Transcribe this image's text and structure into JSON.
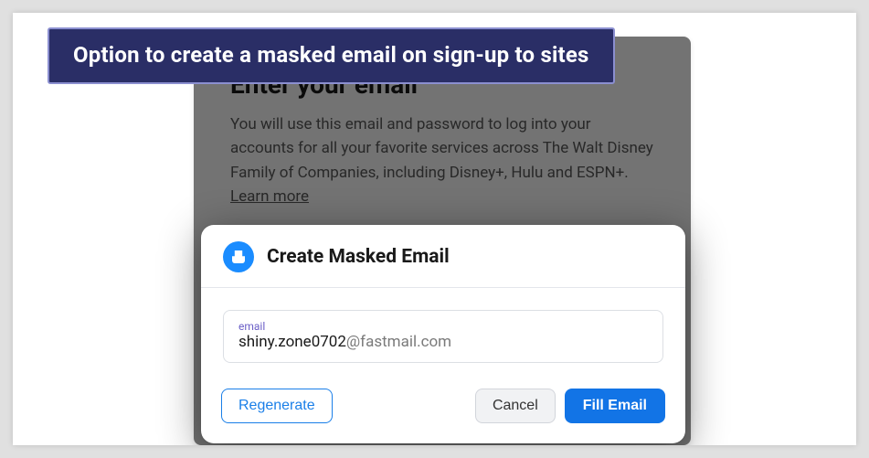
{
  "caption": "Option to create a masked email on sign-up to sites",
  "signup": {
    "title": "Enter your email",
    "description_prefix": "You will use this email and password to log into your accounts for all your favorite services across The Walt Disney Family of Companies, including Disney+, Hulu and ESPN+. ",
    "learn_more": "Learn more"
  },
  "popup": {
    "title": "Create Masked Email",
    "field_label": "email",
    "email_local": "shiny.zone0702",
    "email_domain": "@fastmail.com",
    "regenerate_label": "Regenerate",
    "cancel_label": "Cancel",
    "fill_label": "Fill Email"
  }
}
